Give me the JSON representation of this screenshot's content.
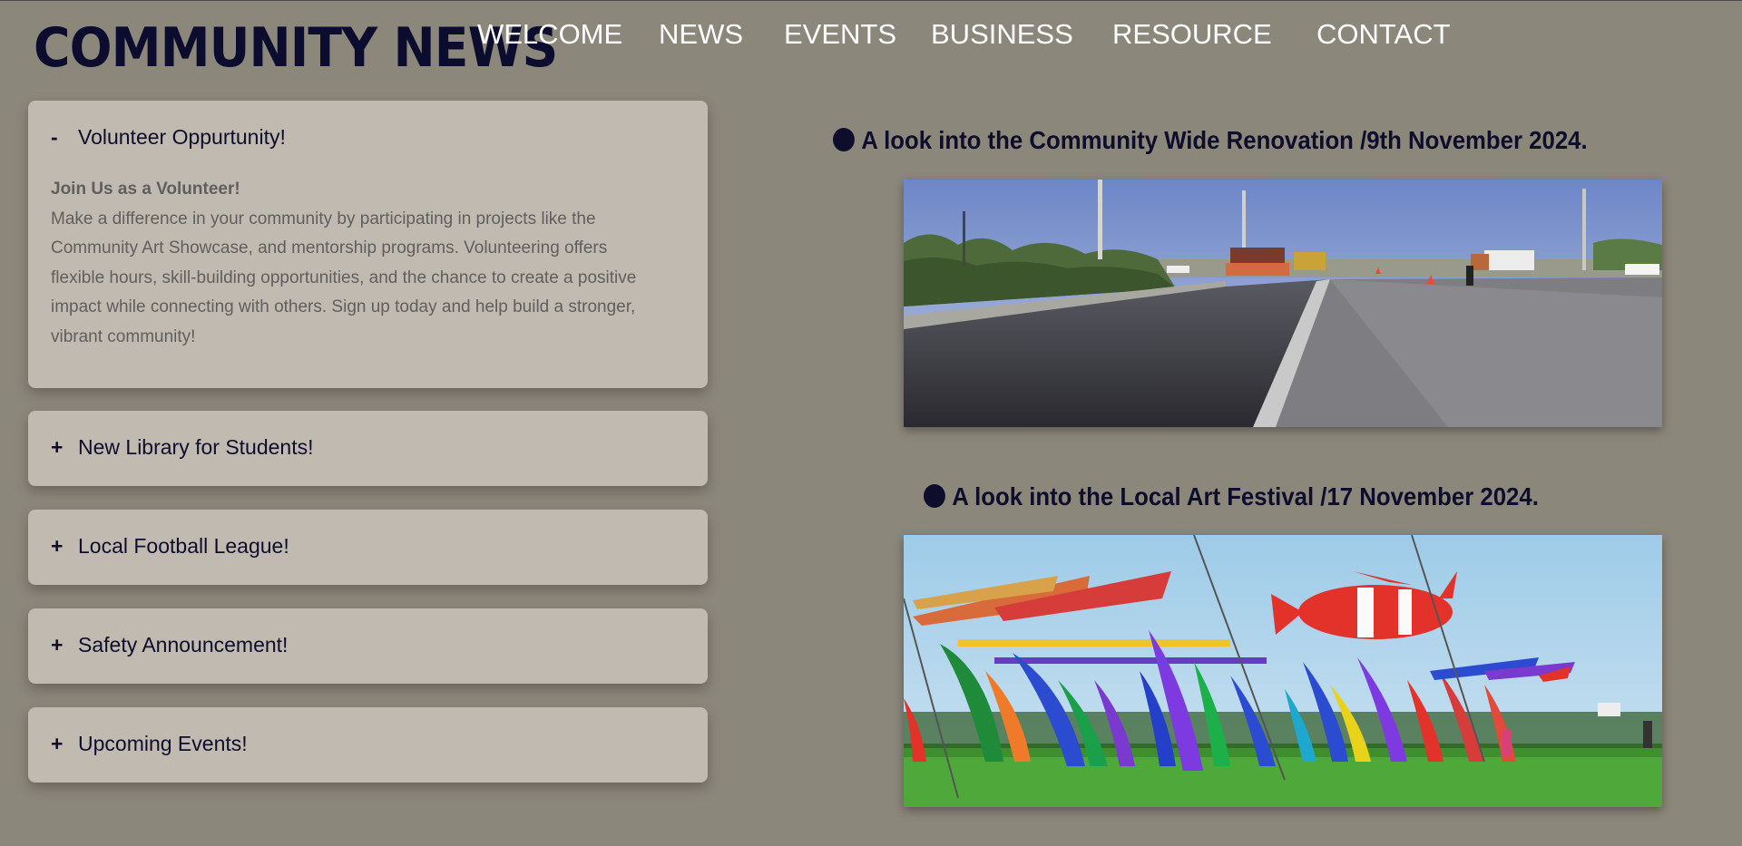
{
  "site": {
    "logo": "COMMUNITY NEWS"
  },
  "nav": {
    "items": [
      "WELCOME",
      "NEWS",
      "EVENTS",
      "BUSINESS",
      "RESOURCE",
      "CONTACT"
    ]
  },
  "accordion": {
    "open": {
      "sign": "-",
      "title": "Volunteer Oppurtunity!",
      "heading": "Join Us as a Volunteer!",
      "lines": [
        "Make a difference in your community by participating in projects like the",
        "Community Art Showcase, and mentorship programs. Volunteering offers",
        "flexible hours, skill-building opportunities, and the chance to create a positive",
        "impact while connecting with others. Sign up today and help build a stronger,",
        "vibrant community!"
      ]
    },
    "collapsed": [
      {
        "sign": "+",
        "title": "New Library for Students!"
      },
      {
        "sign": "+",
        "title": "Local Football League!"
      },
      {
        "sign": "+",
        "title": "Safety Announcement!"
      },
      {
        "sign": "+",
        "title": "Upcoming Events!"
      }
    ]
  },
  "articles": [
    {
      "title": "A look into the Community Wide Renovation /9th November 2024.",
      "image": "road-renovation-photo"
    },
    {
      "title": "A look into the Local Art Festival /17 November 2024.",
      "image": "kite-festival-photo"
    }
  ],
  "colors": {
    "background": "#8c877b",
    "panel": "#c1bab0",
    "navy": "#0e0e2c",
    "nav_text": "#ffffff",
    "body_text": "#5f5f5f"
  }
}
